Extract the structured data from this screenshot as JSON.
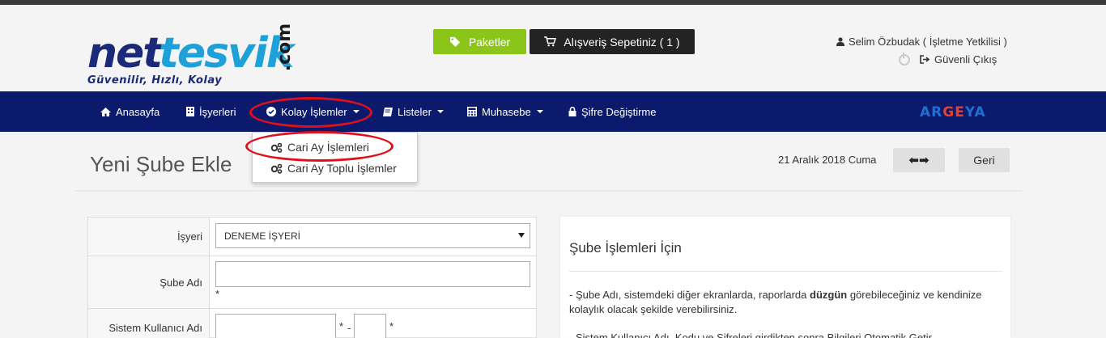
{
  "header": {
    "logo": {
      "net": "net",
      "tesvik": "tesvik",
      "com": ".com",
      "tagline": "Güvenilir, Hızlı, Kolay"
    },
    "paket_label": "Paketler",
    "sepet_label": "Alışveriş Sepetiniz ( 1 )",
    "user_label": "Selim Özbudak ( İşletme Yetkilisi )",
    "logout_label": "Güvenli Çıkış"
  },
  "nav": {
    "items": [
      {
        "label": "Anasayfa"
      },
      {
        "label": "İşyerleri"
      },
      {
        "label": "Kolay İşlemler"
      },
      {
        "label": "Listeler"
      },
      {
        "label": "Muhasebe"
      },
      {
        "label": "Şifre Değiştirme"
      }
    ],
    "brand": {
      "parts": [
        "AR",
        "GE",
        "YA"
      ]
    }
  },
  "dropdown": {
    "items": [
      {
        "label": "Cari Ay İşlemleri"
      },
      {
        "label": "Cari Ay Toplu İşlemler"
      }
    ]
  },
  "page": {
    "title": "Yeni Şube Ekle",
    "date": "21 Aralık 2018 Cuma",
    "arrows_label": "⬅➡",
    "back_label": "Geri"
  },
  "form": {
    "isyeri_label": "İşyeri",
    "isyeri_value": "DENEME İŞYERİ",
    "sube_adi_label": "Şube Adı",
    "sistem_label": "Sistem Kullanıcı Adı",
    "required_mark": "*",
    "dash_mark": "-"
  },
  "info": {
    "title": "Şube İşlemleri İçin",
    "p1_a": "- Şube Adı, sistemdeki diğer ekranlarda, raporlarda ",
    "p1_b": "düzgün",
    "p1_c": " görebileceğiniz ve kendinize kolaylık olacak şekilde verebilirsiniz.",
    "p2": "- Sistem Kullanıcı Adı, Kodu ve Şifreleri girdikten sonra Bilgileri Otomatik Getir"
  },
  "colors": {
    "navbar": "#0c1a6e",
    "paket_button": "#8bc51a",
    "sepet_button": "#232323",
    "highlight_oval": "#e0101a",
    "brand_ar": "#1e6fd0",
    "brand_ge": "#e8402a",
    "brand_ya": "#1e6fd0"
  }
}
